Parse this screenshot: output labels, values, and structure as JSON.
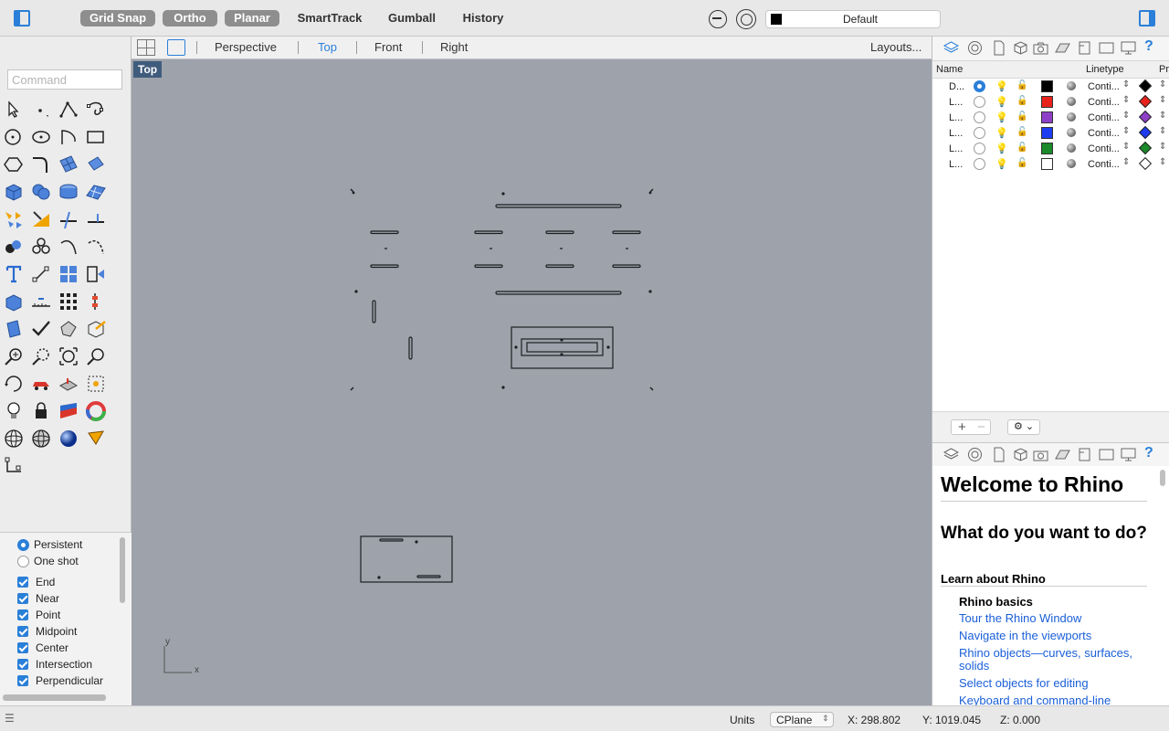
{
  "toolbar": {
    "grid_snap": "Grid Snap",
    "ortho": "Ortho",
    "planar": "Planar",
    "smarttrack": "SmartTrack",
    "gumball": "Gumball",
    "history": "History",
    "current_layer": "Default",
    "current_layer_color": "#000000"
  },
  "command": {
    "placeholder": "Command"
  },
  "viewport_tabs": {
    "perspective": "Perspective",
    "top": "Top",
    "front": "Front",
    "right": "Right",
    "layouts": "Layouts..."
  },
  "viewport": {
    "label": "Top",
    "axis_x": "x",
    "axis_y": "y"
  },
  "snaps": {
    "persistent": "Persistent",
    "one_shot": "One shot",
    "items": [
      "End",
      "Near",
      "Point",
      "Midpoint",
      "Center",
      "Intersection",
      "Perpendicular"
    ]
  },
  "layers": {
    "col_name": "Name",
    "col_linetype": "Linetype",
    "col_print": "Pr",
    "rows": [
      {
        "name": "D...",
        "linetype": "Conti...",
        "color": "#000000"
      },
      {
        "name": "L...",
        "linetype": "Conti...",
        "color": "#e8231c"
      },
      {
        "name": "L...",
        "linetype": "Conti...",
        "color": "#8e3fc8"
      },
      {
        "name": "L...",
        "linetype": "Conti...",
        "color": "#1e3cf0"
      },
      {
        "name": "L...",
        "linetype": "Conti...",
        "color": "#1a8a2a"
      },
      {
        "name": "L...",
        "linetype": "Conti...",
        "color": "#ffffff"
      }
    ]
  },
  "help": {
    "title": "Welcome to Rhino",
    "subtitle": "What do you want to do?",
    "section": "Learn about Rhino",
    "subsection": "Rhino basics",
    "links": [
      "Tour the Rhino Window",
      "Navigate in the viewports",
      "Rhino objects—curves, surfaces, solids",
      "Select objects for editing",
      "Keyboard and command-line"
    ]
  },
  "status": {
    "units": "Units",
    "cplane": "CPlane",
    "x": "X: 298.802",
    "y": "Y: 1019.045",
    "z": "Z: 0.000"
  }
}
